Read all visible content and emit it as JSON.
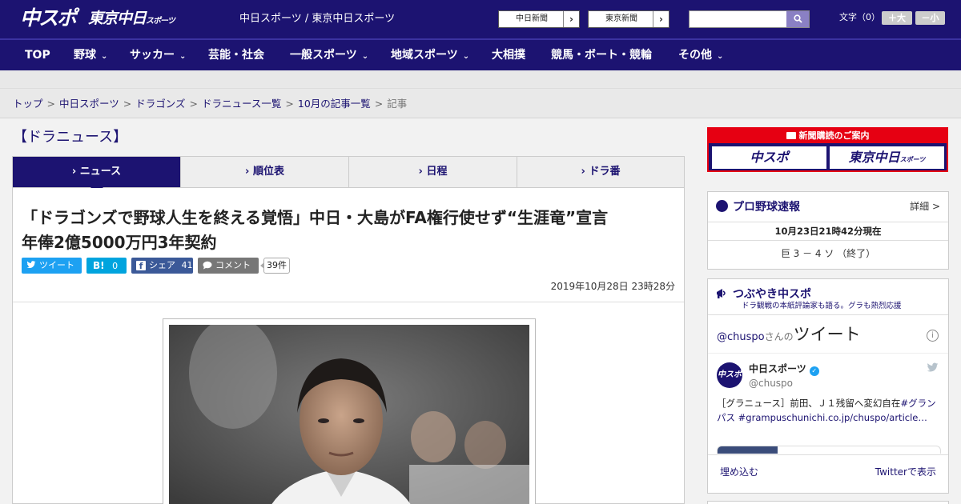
{
  "header": {
    "logo_chuspo": "中スポ",
    "logo_tokyo": "東京中日",
    "logo_tokyo_small": "スポーツ",
    "site_name": "中日スポーツ / 東京中日スポーツ",
    "ext_links": [
      "中日新聞",
      "東京新聞"
    ],
    "search_placeholder": "",
    "font_size_label": "文字（0）",
    "font_bigger": "＋大",
    "font_smaller": "－小"
  },
  "nav": {
    "items": [
      {
        "label": "TOP",
        "chevron": false
      },
      {
        "label": "野球",
        "chevron": true
      },
      {
        "label": "サッカー",
        "chevron": true
      },
      {
        "label": "芸能・社会",
        "chevron": false
      },
      {
        "label": "一般スポーツ",
        "chevron": true
      },
      {
        "label": "地域スポーツ",
        "chevron": true
      },
      {
        "label": "大相撲",
        "chevron": false
      },
      {
        "label": "競馬・ボート・競輪",
        "chevron": false
      },
      {
        "label": "その他",
        "chevron": true
      }
    ]
  },
  "breadcrumb": {
    "items": [
      "トップ",
      "中日スポーツ",
      "ドラゴンズ",
      "ドラニュース一覧",
      "10月の記事一覧"
    ],
    "current": "記事",
    "separator": ">"
  },
  "section_title": "【ドラニュース】",
  "tabs": [
    {
      "label": "ニュース",
      "active": true
    },
    {
      "label": "順位表",
      "active": false
    },
    {
      "label": "日程",
      "active": false
    },
    {
      "label": "ドラ番",
      "active": false
    }
  ],
  "tab_prefix": "›",
  "article": {
    "headline_line1": "「ドラゴンズで野球人生を終える覚悟」中日・大島がFA権行使せず“生涯竜”宣言",
    "headline_line2": "年俸2億5000万円3年契約",
    "share": {
      "tweet": "ツイート",
      "hatena_icon": "B!",
      "hatena_count": "0",
      "facebook": "シェア",
      "facebook_count": "41",
      "comment": "コメント",
      "comment_count": "39件"
    },
    "date": "2019年10月28日 23時28分"
  },
  "sidebar": {
    "ad_title": "新聞購読のご案内",
    "ad_logo_1": "中スポ",
    "ad_logo_2": "東京中日",
    "ad_logo_2_small": "スポーツ",
    "baseball": {
      "title": "プロ野球速報",
      "detail": "詳細 >",
      "time": "10月23日21時42分現在",
      "score": "巨 3 － 4 ソ （終了）"
    },
    "twitter": {
      "title": "つぶやき中スポ",
      "subtitle": "ドラ観戦の本紙評論家も語る。グラも熱烈応援",
      "from_handle": "@chuspo",
      "from_mid": "さんの",
      "from_big": "ツイート",
      "info": "i",
      "name": "中日スポーツ",
      "verified": "✓",
      "handle": "@chuspo",
      "avatar_text": "中スポ",
      "text_plain": "［グラニュース］前田、Ｊ１残留へ変幻自在",
      "text_link1": "#グランパス",
      "text_link2": "#grampus",
      "text_link3": "chunichi.co.jp/chuspo/article…",
      "embed": "埋め込む",
      "view_on": "Twitterで表示"
    }
  },
  "colors": {
    "brand_navy": "#1c1371",
    "twitter": "#1da1f2",
    "hatena": "#00a4de",
    "facebook": "#3b5998",
    "comment_gray": "#777777",
    "ad_red": "#e60012"
  },
  "icons": {
    "search": "search-icon",
    "chevron": "chevron-down-icon",
    "tab_arrow": "chevron-right-icon",
    "baseball": "baseball-icon",
    "megaphone": "megaphone-icon",
    "bird": "twitter-bird-icon",
    "info": "info-icon"
  }
}
